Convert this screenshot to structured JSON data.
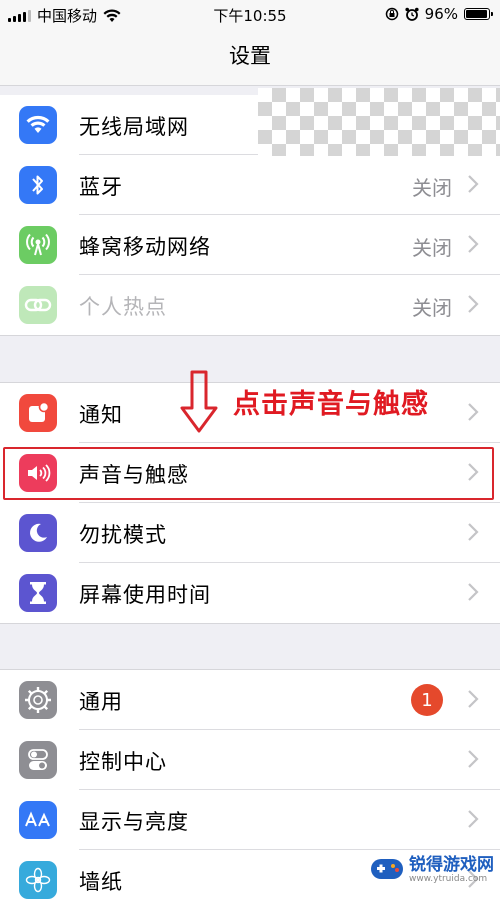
{
  "status_bar": {
    "carrier": "中国移动",
    "time": "下午10:55",
    "battery_percent": "96%",
    "battery_level": 0.96,
    "icons": [
      "signal-icon",
      "wifi-icon",
      "rotation-lock-icon",
      "alarm-icon",
      "battery-icon"
    ]
  },
  "nav": {
    "title": "设置"
  },
  "groups": [
    {
      "rows": [
        {
          "label": "无线局域网",
          "value": "",
          "icon": "wifi-icon",
          "color": "#3478f6"
        },
        {
          "label": "蓝牙",
          "value": "关闭",
          "icon": "bluetooth-icon",
          "color": "#3478f6"
        },
        {
          "label": "蜂窝移动网络",
          "value": "关闭",
          "icon": "cellular-antenna-icon",
          "color": "#6ccc63"
        },
        {
          "label": "个人热点",
          "value": "关闭",
          "icon": "hotspot-link-icon",
          "color": "#bfe8b9",
          "dimmed": true
        }
      ]
    },
    {
      "rows": [
        {
          "label": "通知",
          "icon": "notification-icon",
          "color": "#f1493d"
        },
        {
          "label": "声音与触感",
          "icon": "speaker-icon",
          "color": "#ed3c5c"
        },
        {
          "label": "勿扰模式",
          "icon": "moon-icon",
          "color": "#5c55d0"
        },
        {
          "label": "屏幕使用时间",
          "icon": "hourglass-icon",
          "color": "#5c55d0"
        }
      ]
    },
    {
      "rows": [
        {
          "label": "通用",
          "badge": "1",
          "icon": "gear-icon",
          "color": "#8e8e93"
        },
        {
          "label": "控制中心",
          "icon": "toggle-switches-icon",
          "color": "#8e8e93"
        },
        {
          "label": "显示与亮度",
          "icon": "text-size-aa-icon",
          "color": "#3478f6"
        },
        {
          "label": "墙纸",
          "icon": "flower-icon",
          "color": "#36aadc"
        }
      ]
    }
  ],
  "annotation": {
    "text": "点击声音与触感",
    "color": "#e01a22"
  },
  "watermark": {
    "name": "锐得游戏网",
    "url": "www.ytruida.com"
  }
}
